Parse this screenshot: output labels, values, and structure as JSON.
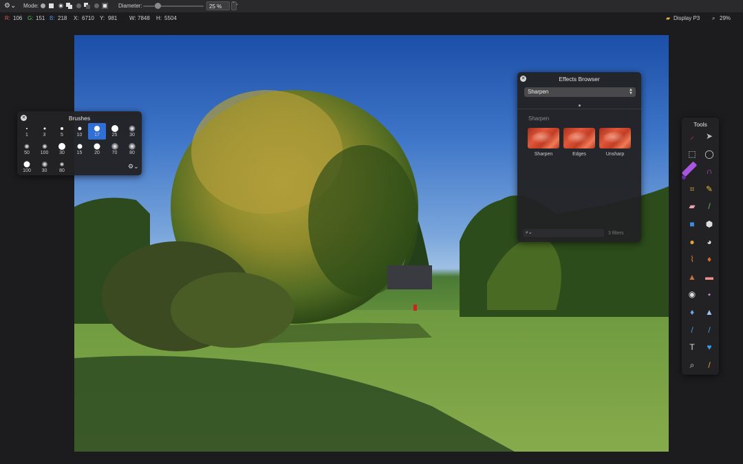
{
  "toolbar": {
    "mode_label": "Mode:",
    "diameter_label": "Diameter:",
    "diameter_value": "25 %",
    "stepper": "⌃⌄"
  },
  "info": {
    "r_label": "R:",
    "r_value": "106",
    "g_label": "G:",
    "g_value": "151",
    "b_label": "B:",
    "b_value": "218",
    "x_label": "X:",
    "x_value": "6710",
    "y_label": "Y:",
    "y_value": "981",
    "w_label": "W:",
    "w_value": "7848",
    "h_label": "H:",
    "h_value": "5504",
    "display_profile": "Display P3",
    "zoom": "29%"
  },
  "brushes": {
    "title": "Brushes",
    "items": [
      {
        "size": "1"
      },
      {
        "size": "3"
      },
      {
        "size": "5"
      },
      {
        "size": "10"
      },
      {
        "size": "17"
      },
      {
        "size": "25"
      },
      {
        "size": "30"
      },
      {
        "size": "50"
      },
      {
        "size": "100"
      },
      {
        "size": "30"
      },
      {
        "size": "15"
      },
      {
        "size": "20"
      },
      {
        "size": "70"
      },
      {
        "size": "80"
      },
      {
        "size": "100"
      },
      {
        "size": "30"
      },
      {
        "size": "80"
      }
    ],
    "selected_index": 4
  },
  "effects": {
    "title": "Effects Browser",
    "category_select": "Sharpen",
    "section_title": "Sharpen",
    "filters": [
      {
        "label": "Sharpen"
      },
      {
        "label": "Edges"
      },
      {
        "label": "Unsharp"
      }
    ],
    "filter_count": "3 filters",
    "search_icon": "⌕⌄"
  },
  "tools": {
    "title": "Tools"
  }
}
